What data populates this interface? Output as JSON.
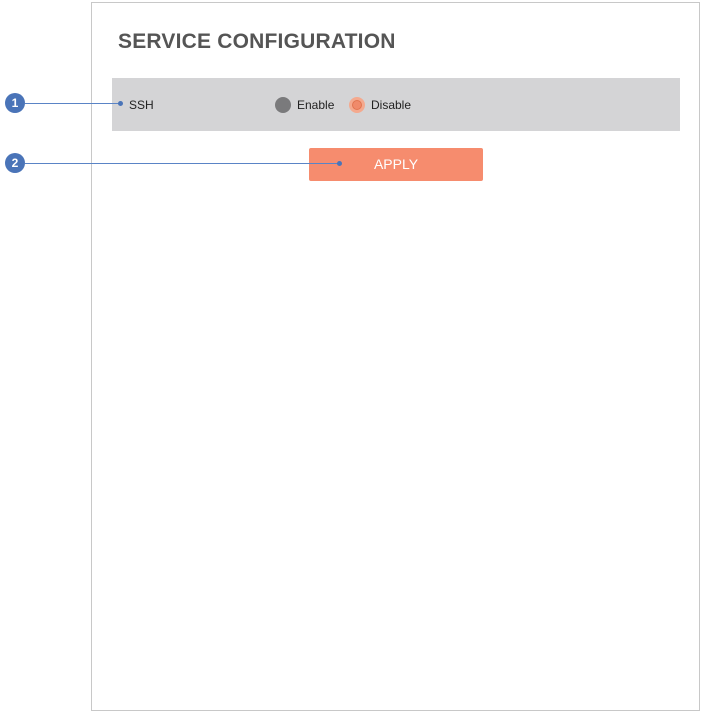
{
  "page": {
    "title": "SERVICE CONFIGURATION"
  },
  "ssh": {
    "label": "SSH",
    "options": [
      {
        "label": "Enable",
        "selected": false
      },
      {
        "label": "Disable",
        "selected": true
      }
    ]
  },
  "actions": {
    "apply_label": "APPLY"
  },
  "callouts": [
    {
      "number": "1"
    },
    {
      "number": "2"
    }
  ],
  "colors": {
    "accent": "#f68c6e",
    "row_background": "#d4d4d6",
    "callout": "#4a74b8",
    "title": "#555555"
  }
}
